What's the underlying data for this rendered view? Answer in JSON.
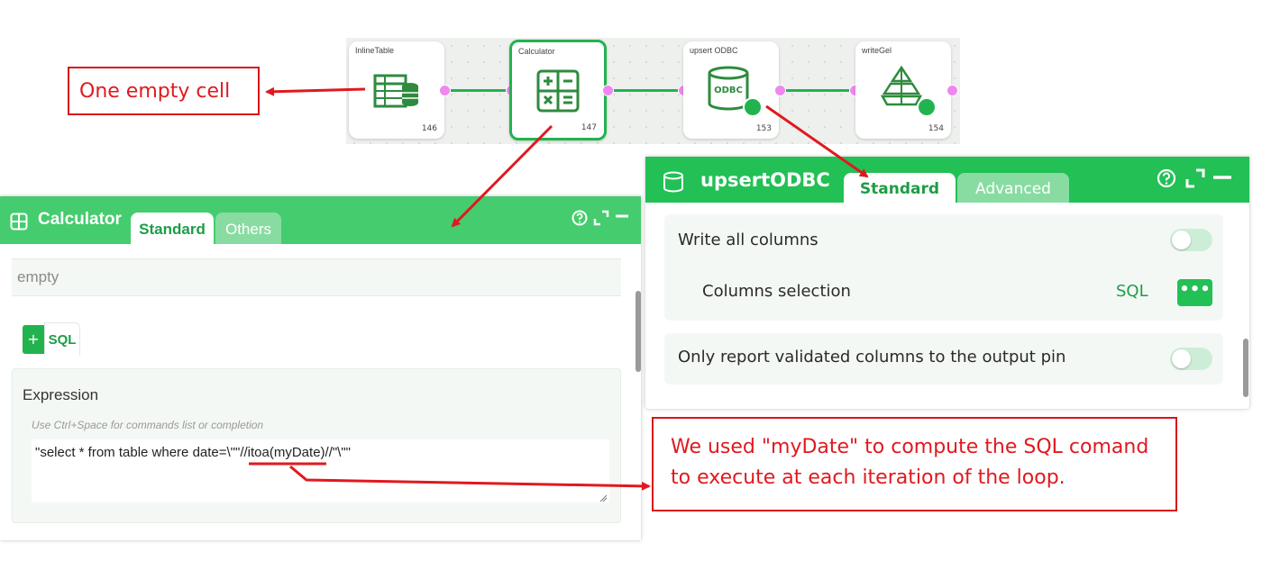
{
  "workflow": {
    "nodes": [
      {
        "title": "InlineTable",
        "number": "146"
      },
      {
        "title": "Calculator",
        "number": "147"
      },
      {
        "title": "upsert ODBC",
        "number": "153",
        "icon_text": "ODBC"
      },
      {
        "title": "writeGel",
        "number": "154"
      }
    ]
  },
  "callouts": {
    "empty_cell": "One empty cell",
    "mydate_line1": "We used \"myDate\" to compute the SQL comand",
    "mydate_line2": "to execute at each iteration of the loop."
  },
  "calculator": {
    "title": "Calculator",
    "tabs": [
      "Standard",
      "Others"
    ],
    "empty_text": "empty",
    "add_button": "+",
    "sql_tab": "SQL",
    "expression_label": "Expression",
    "expression_hint": "Use Ctrl+Space for commands list or completion",
    "expression_value": "\"select * from table where date=\\\"\"//itoa(myDate)//\"\\\"\""
  },
  "upsert_odbc": {
    "title": "upsertODBC",
    "tabs": [
      "Standard",
      "Advanced"
    ],
    "write_all_columns": "Write all columns",
    "columns_selection": "Columns selection",
    "columns_selection_value": "SQL",
    "dots_button": "•••",
    "only_report": "Only report validated columns to the output pin"
  },
  "colors": {
    "accent": "#22c055",
    "callout": "#e0191f",
    "pin": "#ee88ee"
  }
}
